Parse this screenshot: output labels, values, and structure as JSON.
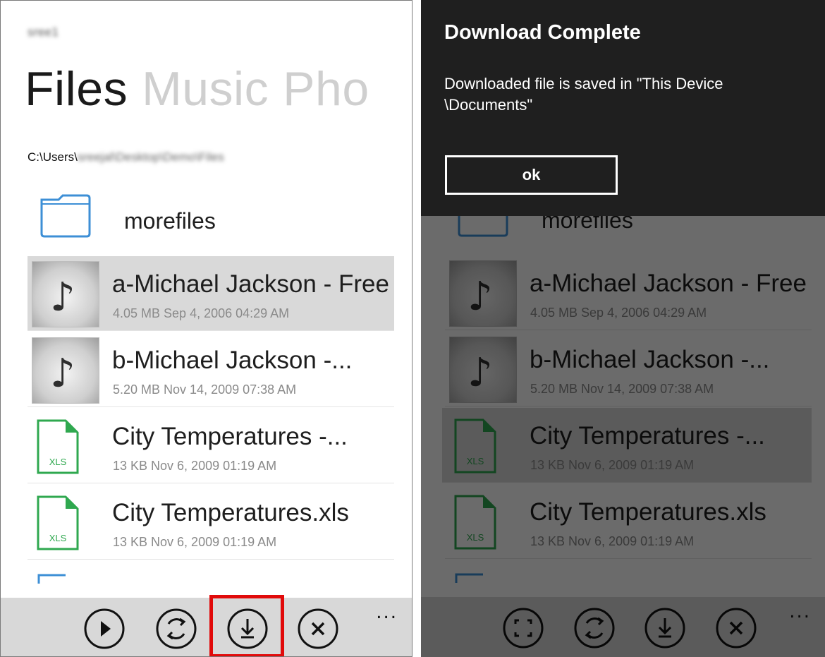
{
  "left": {
    "account_name": "sree1",
    "pivot": {
      "active": "Files",
      "others": [
        "Music",
        "Pho"
      ]
    },
    "path": {
      "prefix": "C:\\Users\\",
      "rest": "sreejal\\Desktop\\Demo\\Files"
    },
    "folder": {
      "name": "morefiles",
      "icon": "folder-icon"
    },
    "files": [
      {
        "name": "a-Michael Jackson - Free",
        "meta": "4.05 MB Sep 4, 2006 04:29 AM",
        "type": "music"
      },
      {
        "name": "b-Michael Jackson -...",
        "meta": "5.20 MB Nov 14, 2009 07:38 AM",
        "type": "music"
      },
      {
        "name": "City Temperatures -...",
        "meta": "13 KB Nov 6, 2009 01:19 AM",
        "type": "xls"
      },
      {
        "name": "City Temperatures.xls",
        "meta": "13 KB Nov 6, 2009 01:19 AM",
        "type": "xls"
      }
    ],
    "appbar": {
      "buttons": [
        "play-icon",
        "sync-icon",
        "download-icon",
        "close-icon"
      ],
      "more": "..."
    },
    "xls_label": "XLS",
    "highlight_color": "#e10a0a"
  },
  "dialog": {
    "title": "Download Complete",
    "message": "Downloaded file is saved in \"This Device \\Documents\"",
    "ok_label": "ok"
  },
  "right": {
    "appbar": {
      "buttons": [
        "fullscreen-icon",
        "sync-icon",
        "download-icon",
        "close-icon"
      ],
      "more": "..."
    }
  }
}
